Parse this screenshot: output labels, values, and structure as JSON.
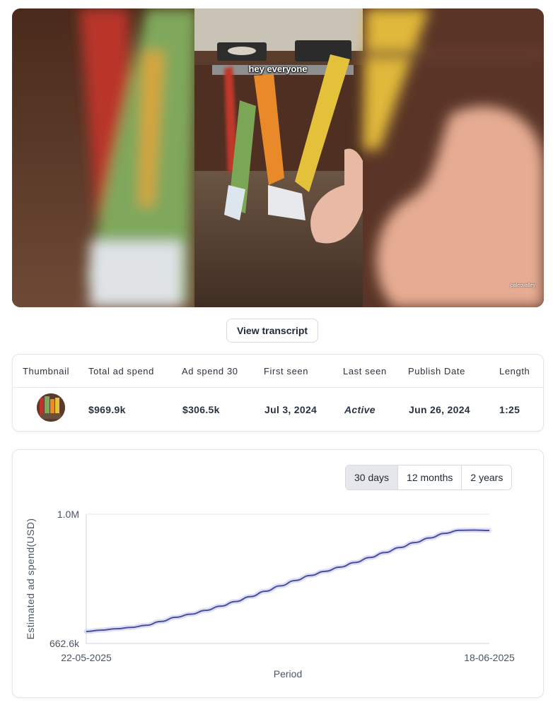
{
  "video": {
    "caption": "hey everyone",
    "watermark": "paleovalley"
  },
  "transcript_button": "View transcript",
  "ad_table": {
    "headers": [
      "Thumbnail",
      "Total ad spend",
      "Ad spend 30",
      "First seen",
      "Last seen",
      "Publish Date",
      "Length"
    ],
    "row": {
      "total_ad_spend": "$969.9k",
      "ad_spend_30": "$306.5k",
      "first_seen": "Jul 3, 2024",
      "last_seen": "Active",
      "publish_date": "Jun 26, 2024",
      "length": "1:25"
    }
  },
  "range_options": [
    "30 days",
    "12 months",
    "2 years"
  ],
  "range_selected": "30 days",
  "chart_data": {
    "type": "line",
    "title": "",
    "xlabel": "Period",
    "ylabel": "Estimated ad spend(USD)",
    "x_tick_labels": [
      "22-05-2025",
      "18-06-2025"
    ],
    "y_tick_labels": [
      "662.6k",
      "1.0M"
    ],
    "ylim": [
      662600,
      1000000
    ],
    "line_color": "#4a4f9c",
    "x": [
      "22-05-2025",
      "23-05-2025",
      "24-05-2025",
      "25-05-2025",
      "26-05-2025",
      "27-05-2025",
      "28-05-2025",
      "29-05-2025",
      "30-05-2025",
      "31-05-2025",
      "01-06-2025",
      "02-06-2025",
      "03-06-2025",
      "04-06-2025",
      "05-06-2025",
      "06-06-2025",
      "07-06-2025",
      "08-06-2025",
      "09-06-2025",
      "10-06-2025",
      "11-06-2025",
      "12-06-2025",
      "13-06-2025",
      "14-06-2025",
      "15-06-2025",
      "16-06-2025",
      "17-06-2025",
      "18-06-2025"
    ],
    "series": [
      {
        "values": [
          694000,
          697500,
          701000,
          704500,
          710000,
          720000,
          731000,
          739000,
          749000,
          760000,
          772000,
          785000,
          799000,
          813000,
          827000,
          840000,
          851000,
          862000,
          874000,
          887000,
          900000,
          913000,
          926000,
          938000,
          950000,
          958000,
          958500,
          957500
        ]
      }
    ]
  }
}
